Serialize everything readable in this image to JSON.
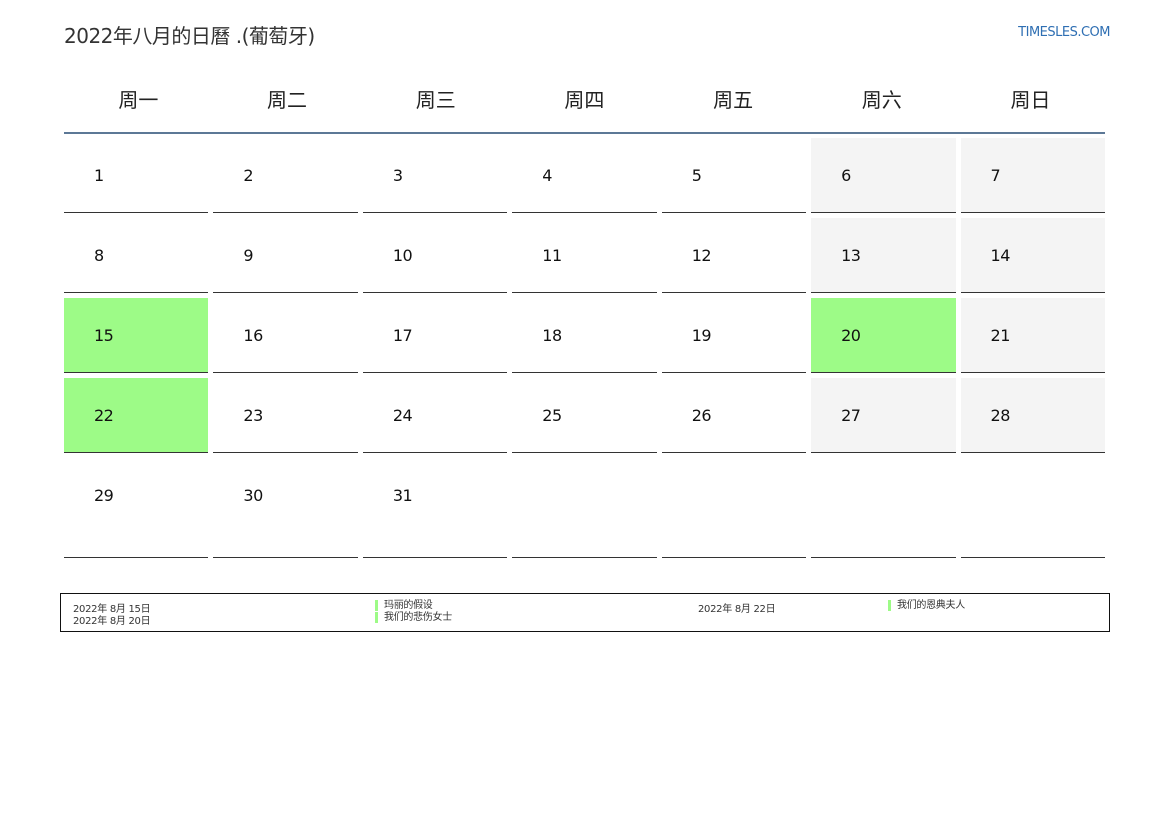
{
  "header": {
    "title": "2022年八月的日曆 .(葡萄牙)",
    "site": "TIMESLES.COM"
  },
  "weekdays": [
    "周一",
    "周二",
    "周三",
    "周四",
    "周五",
    "周六",
    "周日"
  ],
  "weeks": [
    [
      "1",
      "2",
      "3",
      "4",
      "5",
      "6",
      "7"
    ],
    [
      "8",
      "9",
      "10",
      "11",
      "12",
      "13",
      "14"
    ],
    [
      "15",
      "16",
      "17",
      "18",
      "19",
      "20",
      "21"
    ],
    [
      "22",
      "23",
      "24",
      "25",
      "26",
      "27",
      "28"
    ],
    [
      "29",
      "30",
      "31",
      "",
      "",
      "",
      ""
    ]
  ],
  "colors": {
    "holiday": "#9dfb87",
    "weekend": "#f4f4f4",
    "header_rule": "#5c7896",
    "site_link": "#2f6fb3"
  },
  "legend": {
    "left_dates": [
      "2022年 8月 15日",
      "2022年 8月 20日"
    ],
    "left_names": [
      "玛丽的假设",
      "我们的悲伤女士"
    ],
    "right_dates": [
      "2022年 8月 22日"
    ],
    "right_names": [
      "我们的恩典夫人"
    ]
  }
}
